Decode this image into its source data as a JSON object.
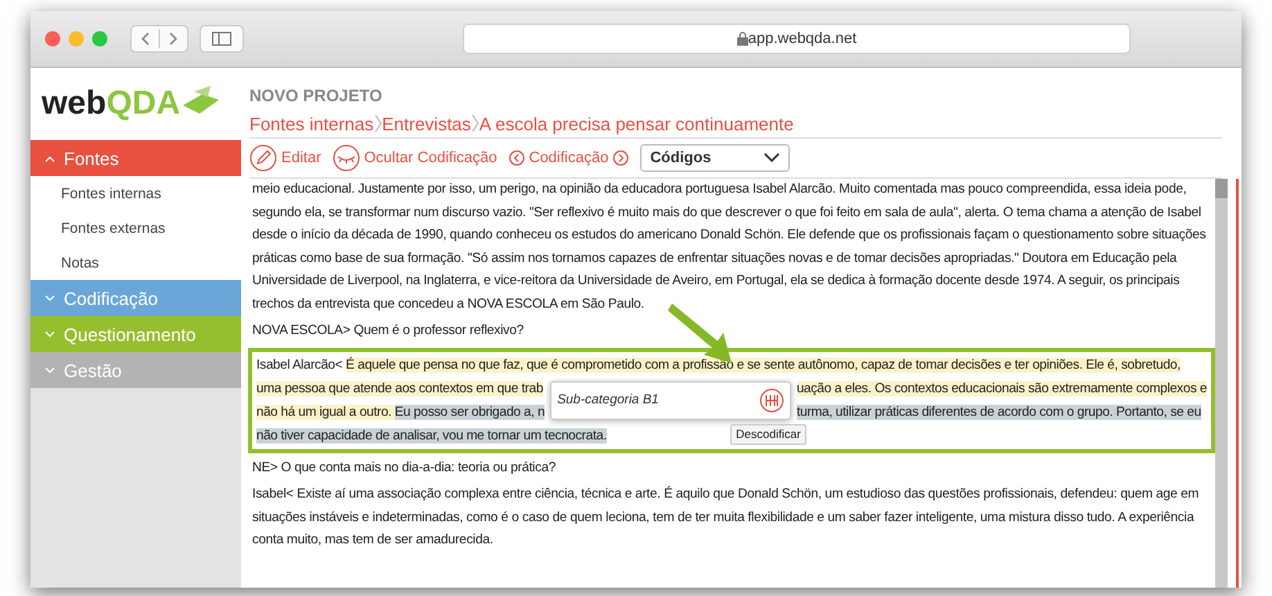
{
  "browser": {
    "url": "app.webqda.net"
  },
  "logo": {
    "text": "web",
    "accent": "QDA"
  },
  "sidebar": [
    {
      "label": "Fontes",
      "expanded": true,
      "color": "#e8503f",
      "children": [
        "Fontes internas",
        "Fontes externas",
        "Notas"
      ]
    },
    {
      "label": "Codificação",
      "expanded": false,
      "color": "#6aa7d8"
    },
    {
      "label": "Questionamento",
      "expanded": false,
      "color": "#96bf30"
    },
    {
      "label": "Gestão",
      "expanded": false,
      "color": "#b3b3b3"
    }
  ],
  "project": "NOVO PROJETO",
  "breadcrumb": [
    "Fontes internas",
    "Entrevistas",
    "A escola precisa pensar continuamente"
  ],
  "toolbar": {
    "edit": "Editar",
    "hide": "Ocultar Codificação",
    "nav": "Codificação",
    "dropdown": "Códigos"
  },
  "document": {
    "cut_line": "meio educacional. Justamente por isso, um perigo, na opinião da educadora portuguesa Isabel Alarcão. Muito comentada mas pouco compreendida, essa ideia pode,",
    "before": [
      "segundo ela, se transformar num discurso vazio. \"Ser reflexivo é muito mais do que descrever o que foi feito em sala de aula\", alerta. O tema chama a atenção de Isabel desde o início da década de 1990, quando conheceu os estudos do americano Donald Schön. Ele defende que os profissionais façam o questionamento sobre situações práticas como base de sua formação. \"Só assim nos tornamos capazes de enfrentar situações novas e de tomar decisões apropriadas.\" Doutora em Educação pela Universidade de Liverpool, na Inglaterra, e vice-reitora da Universidade de Aveiro, em Portugal, ela se dedica à formação docente desde 1974. A seguir, os principais trechos da entrevista que concedeu a NOVA ESCOLA em São Paulo.",
      "NOVA ESCOLA> Quem é o professor reflexivo?"
    ],
    "coded_lines": [
      {
        "left": [
          {
            "text": "Isabel Alarcão< ",
            "kind": "plain"
          },
          {
            "text": "É aquele que pensa no que faz, que é comprometido com a profissão e se sente autônomo, capaz de tomar decisões e ter opiniões. Ele é, sobretudo,",
            "kind": "yellow"
          }
        ]
      },
      {
        "left": [
          {
            "text": "uma pessoa que atende aos contextos em que trab",
            "kind": "yellow"
          }
        ],
        "right": [
          {
            "text": "uação a eles. Os contextos educacionais são extremamente complexos e",
            "kind": "yellow"
          }
        ]
      },
      {
        "left": [
          {
            "text": "não há um igual a outro. ",
            "kind": "yellow"
          },
          {
            "text": "Eu posso ser obrigado a, n",
            "kind": "blue"
          }
        ],
        "right": [
          {
            "text": "turma, utilizar práticas diferentes de acordo com o grupo. Portanto, se eu",
            "kind": "blue"
          }
        ]
      },
      {
        "left": [
          {
            "text": "não tiver capacidade de analisar, vou me tornar um tecnocrata.",
            "kind": "blue"
          }
        ]
      }
    ],
    "popup": {
      "label": "Sub-categoria B1",
      "tooltip": "Descodificar"
    },
    "after": [
      "NE> O que conta mais no dia-a-dia: teoria ou prática?",
      "Isabel< Existe aí uma associação complexa entre ciência, técnica e arte. É aquilo que Donald Schön, um estudioso das questões profissionais, defendeu: quem age em situações instáveis e indeterminadas, como é o caso de quem leciona, tem de ter muita flexibilidade e um saber fazer inteligente, uma mistura disso tudo. A experiência conta muito, mas tem de ser amadurecida."
    ]
  }
}
